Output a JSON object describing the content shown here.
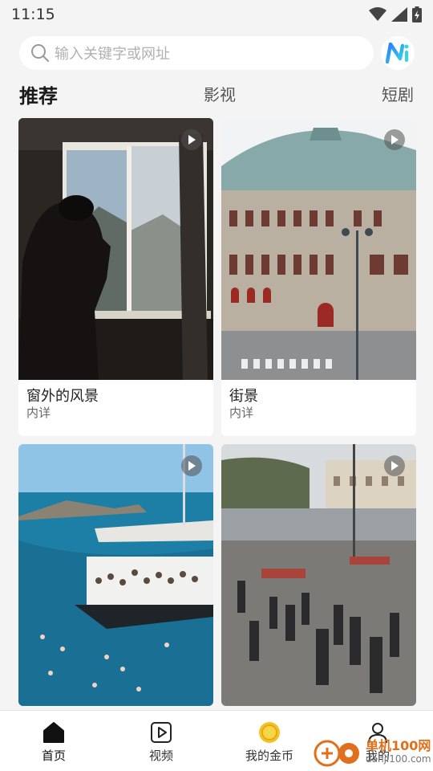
{
  "status_bar": {
    "time": "11:15"
  },
  "search": {
    "placeholder": "输入关键字或网址"
  },
  "tabs": [
    {
      "label": "推荐",
      "active": true
    },
    {
      "label": "影视",
      "active": false
    },
    {
      "label": "短剧",
      "active": false
    }
  ],
  "cards": [
    {
      "title": "窗外的风景",
      "subtitle": "内详"
    },
    {
      "title": "街景",
      "subtitle": "内详"
    },
    {
      "title": "",
      "subtitle": ""
    },
    {
      "title": "",
      "subtitle": ""
    }
  ],
  "bottom_nav": [
    {
      "label": "首页",
      "icon": "home-icon",
      "active": true
    },
    {
      "label": "视频",
      "icon": "video-icon",
      "active": false
    },
    {
      "label": "我的金币",
      "icon": "gold-coin-icon",
      "active": false
    },
    {
      "label": "我的",
      "icon": "profile-icon",
      "active": false
    }
  ],
  "watermark": {
    "main": "单机100网",
    "url": "danji100.com"
  },
  "colors": {
    "accent": "#e26f1c",
    "logo_gradient_start": "#2a7cff",
    "logo_gradient_end": "#33d6e8",
    "coin": "#f6c228"
  }
}
